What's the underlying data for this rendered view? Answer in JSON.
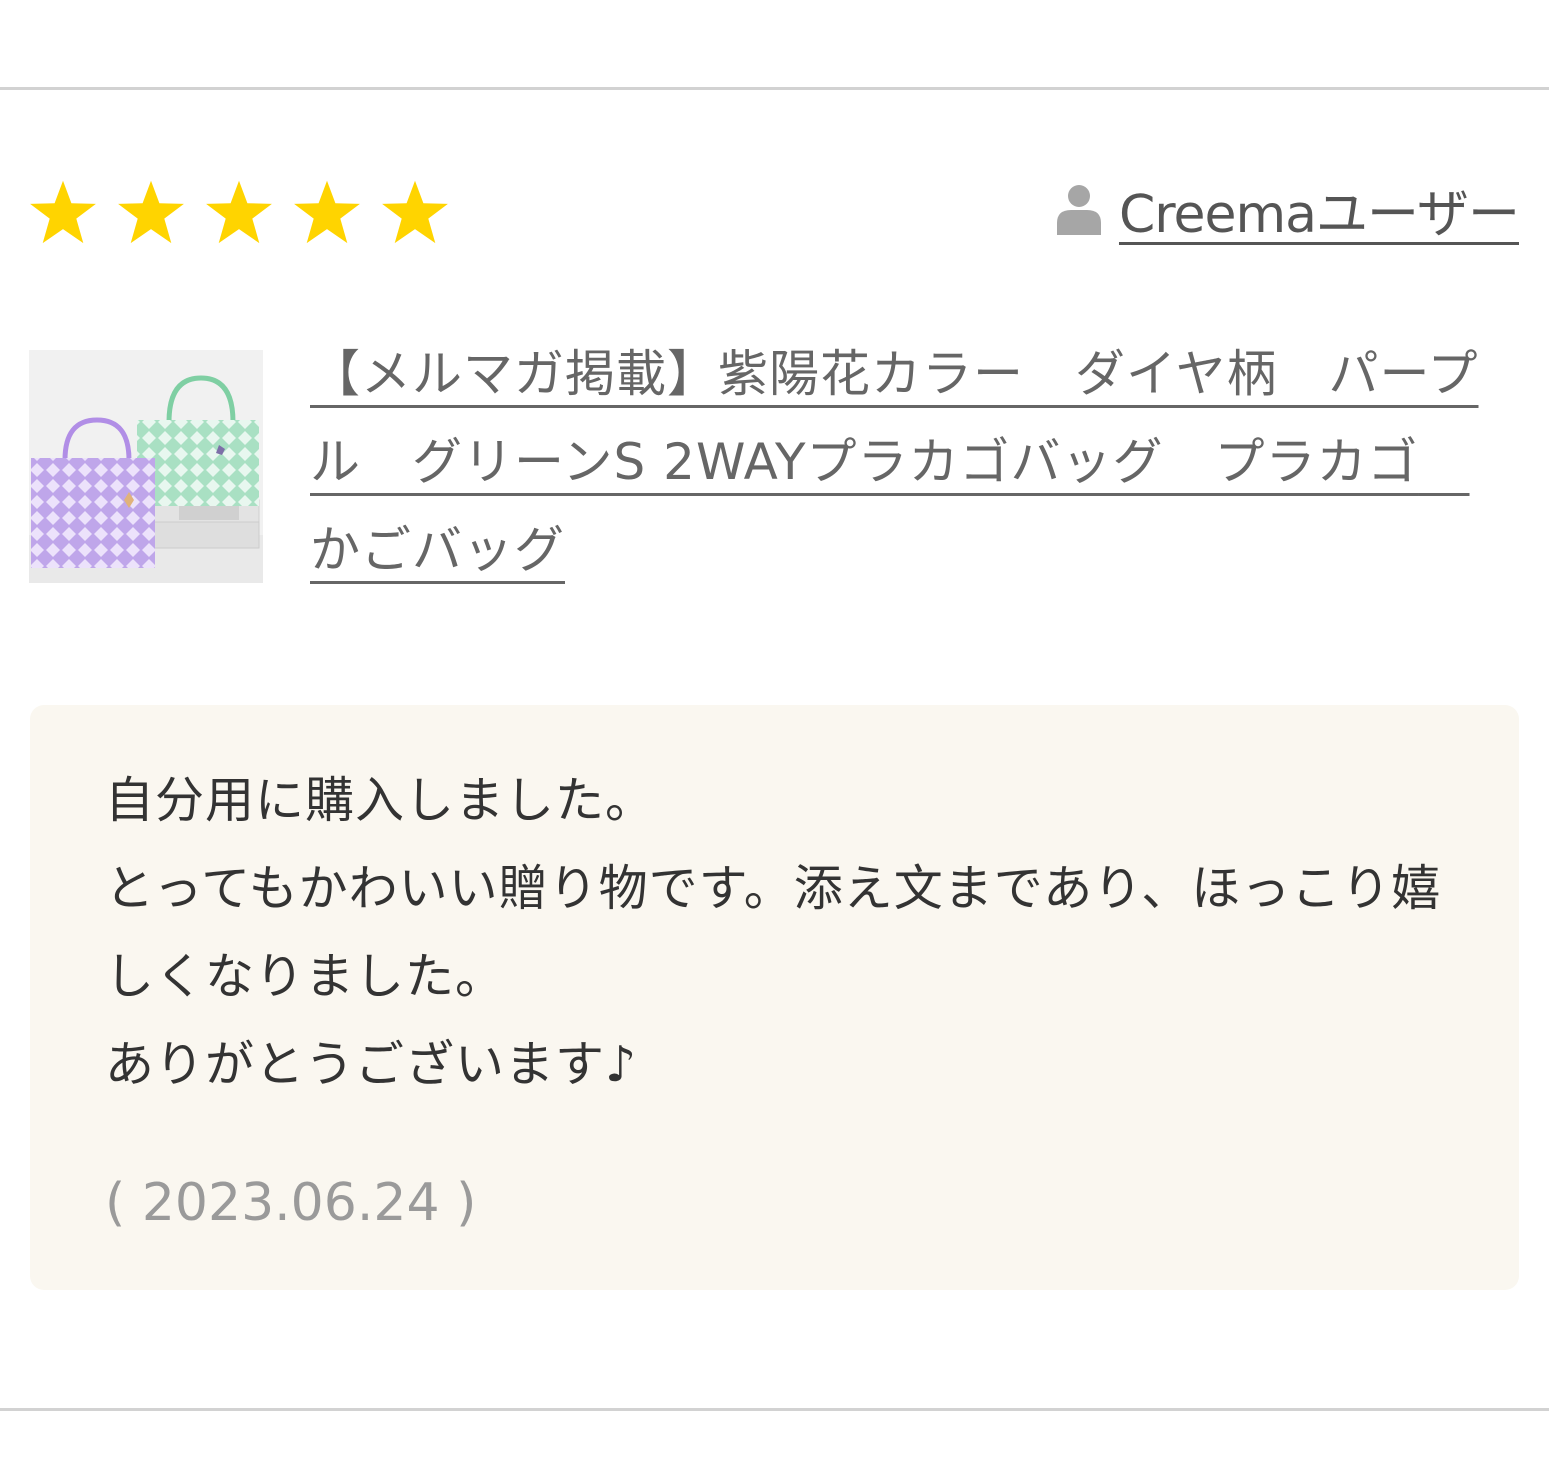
{
  "rating": {
    "value": 5,
    "max": 5,
    "star_color": "#ffd400"
  },
  "user": {
    "icon": "user-silhouette-icon",
    "name": "Creemaユーザー"
  },
  "product": {
    "thumbnail": "tote-bags-product-image",
    "title": "【メルマガ掲載】紫陽花カラー　ダイヤ柄　パープル　グリーンS 2WAYプラカゴバッグ　プラカゴ　かごバッグ"
  },
  "review": {
    "text": "自分用に購入しました。\nとってもかわいい贈り物です。添え文まであり、ほっこり嬉しくなりました。\nありがとうございます♪",
    "date": "( 2023.06.24 )",
    "background": "#faf7f0"
  }
}
